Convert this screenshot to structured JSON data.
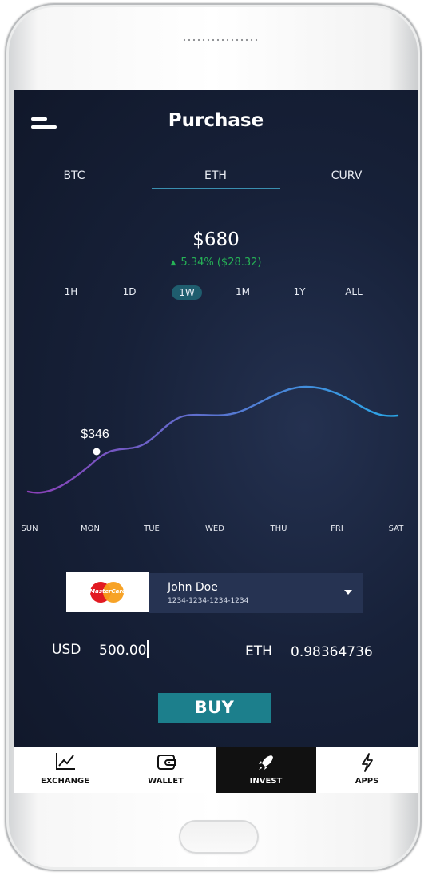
{
  "header": {
    "title": "Purchase",
    "menu_icon": "menu-icon"
  },
  "tabs": [
    {
      "label": "BTC",
      "active": false
    },
    {
      "label": "ETH",
      "active": true
    },
    {
      "label": "CURV",
      "active": false
    }
  ],
  "price": {
    "value": "$680",
    "change": "5.34% ($28.32)",
    "direction": "up",
    "change_color": "#26b356"
  },
  "ranges": [
    {
      "label": "1H",
      "active": false
    },
    {
      "label": "1D",
      "active": false
    },
    {
      "label": "1W",
      "active": true
    },
    {
      "label": "1M",
      "active": false
    },
    {
      "label": "1Y",
      "active": false
    },
    {
      "label": "ALL",
      "active": false
    }
  ],
  "chart_data": {
    "type": "line",
    "categories": [
      "SUN",
      "MON",
      "TUE",
      "WED",
      "THU",
      "FRI",
      "SAT"
    ],
    "highlight": {
      "category": "MON",
      "label": "$346"
    },
    "gradient": [
      "#8b3fb7",
      "#2aa7e8"
    ],
    "grid": true
  },
  "payment": {
    "brand": "MasterCard",
    "name": "John Doe",
    "number": "1234-1234-1234-1234",
    "dropdown_icon": "chevron-down-icon"
  },
  "conversion": {
    "from_label": "USD",
    "from_value": "500.00",
    "to_label": "ETH",
    "to_value": "0.98364736"
  },
  "buy_label": "BUY",
  "accent": "#1c7f8c",
  "nav": [
    {
      "label": "EXCHANGE",
      "icon": "chart-icon",
      "active": false
    },
    {
      "label": "WALLET",
      "icon": "wallet-icon",
      "active": false
    },
    {
      "label": "INVEST",
      "icon": "rocket-icon",
      "active": true
    },
    {
      "label": "APPS",
      "icon": "lightning-icon",
      "active": false
    }
  ]
}
